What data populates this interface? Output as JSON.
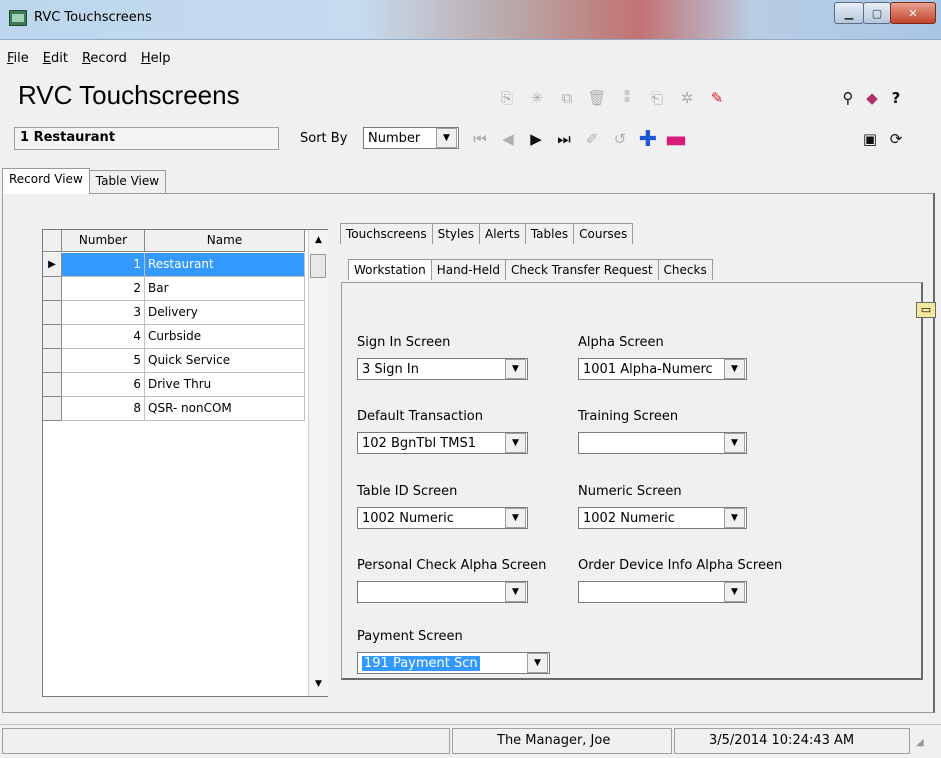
{
  "window": {
    "title": "RVC Touchscreens"
  },
  "menu": [
    "File",
    "Edit",
    "Record",
    "Help"
  ],
  "header": {
    "title": "RVC Touchscreens",
    "current_record": "1 Restaurant",
    "sort_by_label": "Sort By",
    "sort_by_value": "Number"
  },
  "view_tabs": [
    "Record View",
    "Table View"
  ],
  "grid": {
    "columns": [
      "Number",
      "Name"
    ],
    "rows": [
      {
        "number": "1",
        "name": "Restaurant"
      },
      {
        "number": "2",
        "name": "Bar"
      },
      {
        "number": "3",
        "name": "Delivery"
      },
      {
        "number": "4",
        "name": "Curbside"
      },
      {
        "number": "5",
        "name": "Quick Service"
      },
      {
        "number": "6",
        "name": "Drive Thru"
      },
      {
        "number": "8",
        "name": "QSR- nonCOM"
      }
    ]
  },
  "tabs_row1": [
    "Touchscreens",
    "Styles",
    "Alerts",
    "Tables",
    "Courses"
  ],
  "tabs_row2": [
    "Workstation",
    "Hand-Held",
    "Check Transfer Request",
    "Checks"
  ],
  "fields": {
    "sign_in_label": "Sign In Screen",
    "sign_in_value": "3  Sign In",
    "alpha_label": "Alpha Screen",
    "alpha_value": "1001  Alpha-Numerc",
    "default_txn_label": "Default Transaction",
    "default_txn_value": "102  BgnTbl TMS1",
    "training_label": "Training Screen",
    "training_value": "",
    "table_id_label": "Table ID Screen",
    "table_id_value": "1002  Numeric",
    "numeric_label": "Numeric Screen",
    "numeric_value": "1002  Numeric",
    "personal_check_label": "Personal Check Alpha Screen",
    "personal_check_value": "",
    "order_device_label": "Order Device Info Alpha Screen",
    "order_device_value": "",
    "payment_label": "Payment Screen",
    "payment_value": "191  Payment Scn"
  },
  "status": {
    "user": "The Manager, Joe",
    "datetime": "3/5/2014 10:24:43 AM"
  },
  "accent_color": "#3399ff"
}
